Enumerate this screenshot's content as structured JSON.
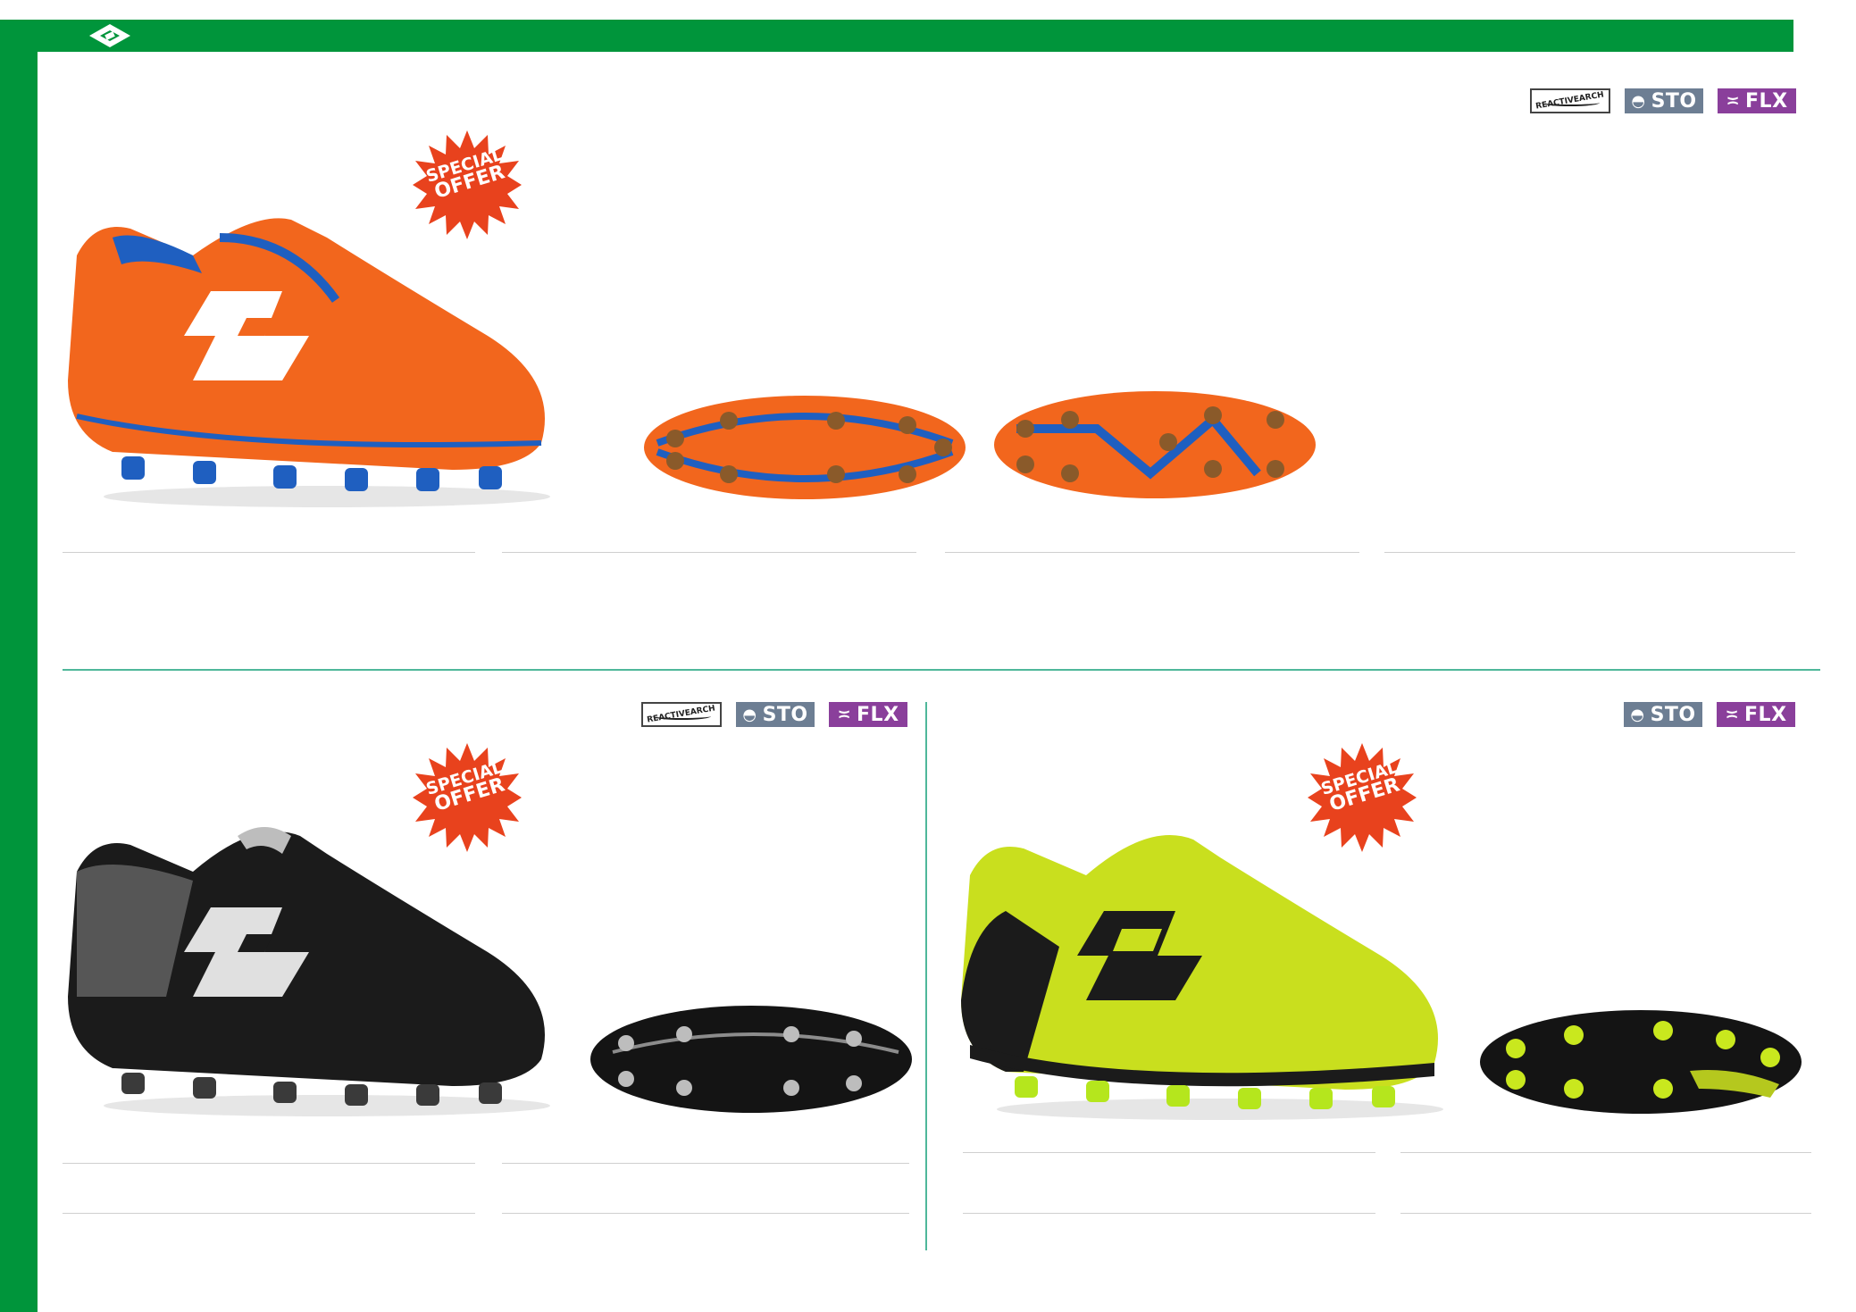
{
  "colors": {
    "brand_green": "#00953b",
    "divider_teal": "#4fb79a",
    "offer_red": "#e8421d",
    "sto_badge": "#6d7e93",
    "flx_badge": "#8a3f9b"
  },
  "brand": {
    "logo_icon": "lotto-diamond-logo"
  },
  "badges": {
    "reactive": "REACTIVEARCH",
    "sto": "STO",
    "flx": "FLX"
  },
  "offer": {
    "line1": "SPECIAL",
    "line2": "OFFER"
  },
  "products": [
    {
      "name": "orange-blue-football-boot",
      "sole_views": 2
    },
    {
      "name": "black-silver-football-boot",
      "sole_views": 1
    },
    {
      "name": "yellow-black-football-boot",
      "sole_views": 1
    }
  ]
}
